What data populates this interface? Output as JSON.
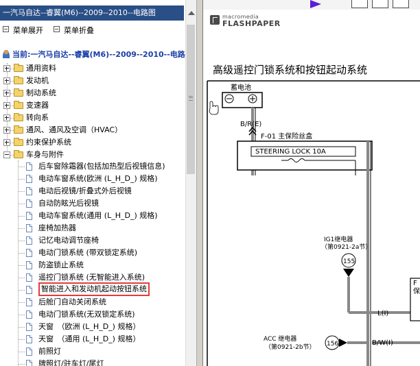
{
  "tree": {
    "title": "一汽马自达--睿翼(M6)--2009--2010--电路图",
    "expand_all": "菜单展开",
    "collapse_all": "菜单折叠",
    "current_path": "当前:一汽马自达--睿翼(M6)--2009--2010--电路",
    "folders": [
      "通用资料",
      "发动机",
      "制动系统",
      "变速器",
      "转向系",
      "通风、通风及空调（HVAC）",
      "约束保护系统",
      "车身与附件"
    ],
    "children": [
      "后车窗除霜器(包括加热型后视镜信息)",
      "电动车窗系统(欧洲 (L_H_D_) 规格)",
      "电动后视镜/折叠式外后视镜",
      "自动防眩光后视镜",
      "电动车窗系统(通用 (L_H_D_) 规格)",
      "座椅加热器",
      "记忆电动调节座椅",
      "电动门锁系统 (带双锁定系统)",
      "防盗锁止系统",
      "遥控门锁系统 (无智能进入系统)",
      "智能进入和发动机起动按钮系统",
      "后舱门自动关闭系统",
      "电动门锁系统(无双锁定系统)",
      "天窗　（欧洲 (L_H_D_) 规格）",
      "天窗　（通用 (L_H_D_) 规格）",
      "前照灯",
      "牌照灯/驻车灯/尾灯"
    ],
    "selected_child": "智能进入和发动机起动按钮系统"
  },
  "viewer": {
    "logo_line1": "macromedia",
    "logo_line2": "FLASHPAPER",
    "doc_title": "高级遥控门锁系统和按钮起动系统",
    "battery_label": "蓄电池",
    "wire_br": "B/R(E)",
    "fuse_box": "F-01 主保险丝盒",
    "fuse_name": "STEERING LOCK 10A",
    "ig1_relay": "IG1继电器",
    "ig1_ref": "（第0921-2a节）",
    "connector_155": "155",
    "wire_l": "L(I)",
    "acc_relay": "ACC 继电器",
    "acc_ref": "（第0921-2b节）",
    "connector_156": "156",
    "wire_bw": "B/W(I)",
    "edge_label_1": "F",
    "edge_label_2": "保"
  },
  "colors": {
    "title_bar": "#2a4f86",
    "selection_border": "#e23c3c",
    "current_link": "#1a3fa8",
    "play_button": "#5b1ed4"
  }
}
